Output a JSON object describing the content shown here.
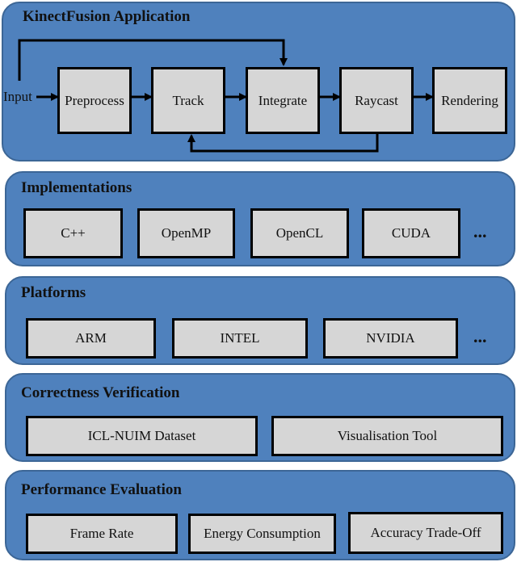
{
  "colors": {
    "panel_fill": "#4f81bd",
    "box_fill": "#d6d6d6",
    "arrow": "#000000"
  },
  "app": {
    "title": "KinectFusion Application",
    "input_label": "Input",
    "stages": [
      "Preprocess",
      "Track",
      "Integrate",
      "Raycast",
      "Rendering"
    ],
    "edges": [
      {
        "from": "Input",
        "to": "Preprocess"
      },
      {
        "from": "Preprocess",
        "to": "Track"
      },
      {
        "from": "Track",
        "to": "Integrate"
      },
      {
        "from": "Integrate",
        "to": "Raycast"
      },
      {
        "from": "Raycast",
        "to": "Rendering"
      },
      {
        "from": "Input",
        "to": "Integrate"
      },
      {
        "from": "Raycast",
        "to": "Track"
      }
    ]
  },
  "implementations": {
    "title": "Implementations",
    "items": [
      "C++",
      "OpenMP",
      "OpenCL",
      "CUDA"
    ],
    "more": "..."
  },
  "platforms": {
    "title": "Platforms",
    "items": [
      "ARM",
      "INTEL",
      "NVIDIA"
    ],
    "more": "..."
  },
  "correctness": {
    "title": "Correctness Verification",
    "items": [
      "ICL-NUIM Dataset",
      "Visualisation Tool"
    ]
  },
  "performance": {
    "title": "Performance Evaluation",
    "items": [
      "Frame Rate",
      "Energy Consumption",
      "Accuracy Trade-Off"
    ]
  }
}
